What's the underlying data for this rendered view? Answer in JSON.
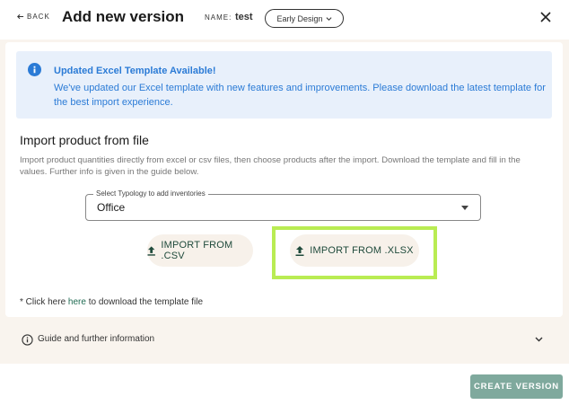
{
  "header": {
    "back_label": "BACK",
    "title": "Add new version",
    "name_label": "NAME:",
    "name_value": "test",
    "version_chip": "Early Design"
  },
  "banner": {
    "title": "Updated Excel Template Available!",
    "text": "We've updated our Excel template with new features and improvements. Please download the latest template for the best import experience."
  },
  "import_section": {
    "title": "Import product from file",
    "description": "Import product quantities directly from excel or csv files, then choose products after the import. Download the template and fill in the values. Further info is given in the guide below.",
    "select_label": "Select Typology to add inventories",
    "select_value": "Office",
    "csv_button": "IMPORT FROM .CSV",
    "xlsx_button": "IMPORT FROM .XLSX",
    "note_prefix": "* Click here ",
    "note_link": "here",
    "note_suffix": " to download the template file"
  },
  "guide": {
    "label": "Guide and further information"
  },
  "footer": {
    "create_button": "CREATE VERSION"
  },
  "colors": {
    "banner_bg": "#e8f0fb",
    "banner_text": "#2b7bd6",
    "highlight": "#b9ec53",
    "create_button_bg": "#7fa99d",
    "body_bg": "#f9f4ee"
  }
}
